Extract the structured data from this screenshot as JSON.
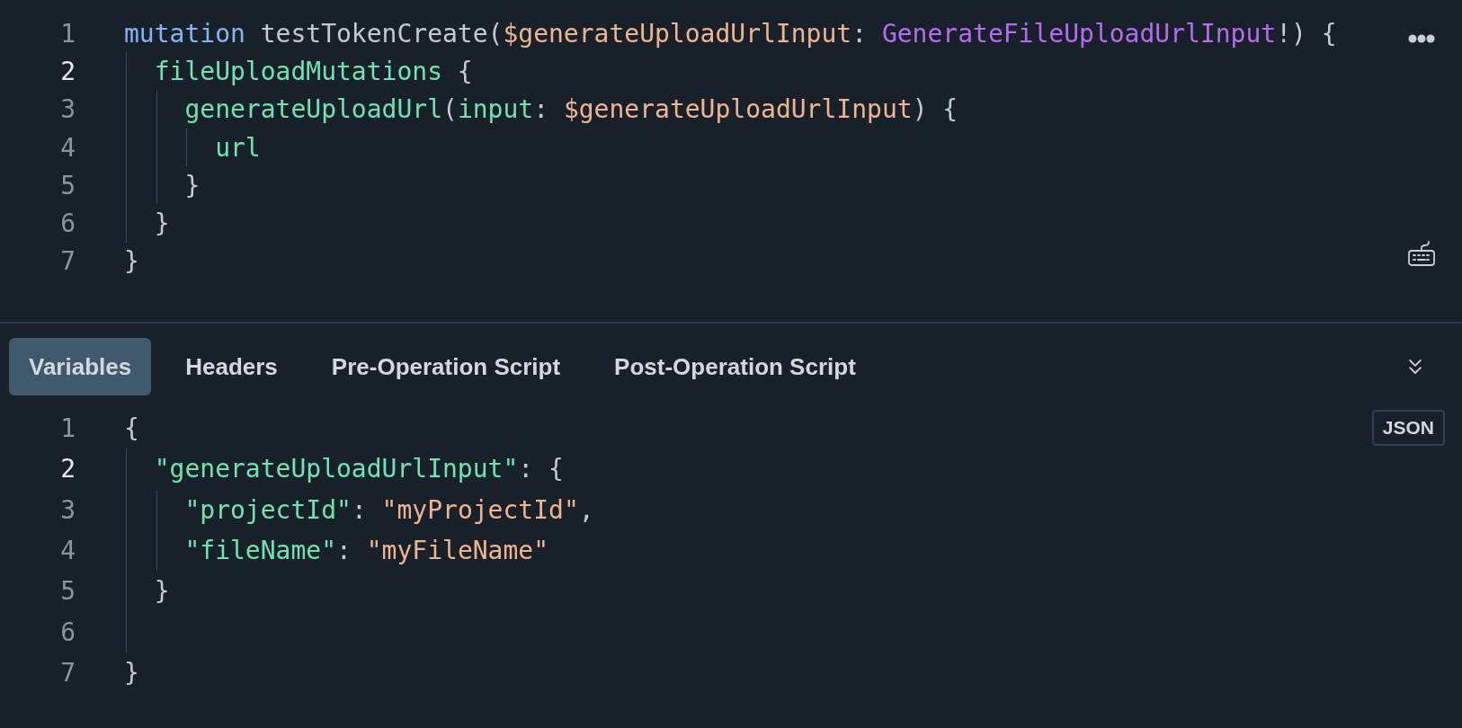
{
  "query_editor": {
    "lines": [
      {
        "number": "1",
        "active": false,
        "tokens": [
          {
            "kind": "keyword",
            "text": "mutation"
          },
          {
            "kind": "plain",
            "text": " testTokenCreate("
          },
          {
            "kind": "variable",
            "text": "$generateUploadUrlInput"
          },
          {
            "kind": "plain",
            "text": ": "
          },
          {
            "kind": "type",
            "text": "GenerateFileUploadUrlInput"
          },
          {
            "kind": "plain",
            "text": "!) {"
          }
        ]
      },
      {
        "number": "2",
        "active": true,
        "tokens": [
          {
            "kind": "field",
            "text": "  fileUploadMutations"
          },
          {
            "kind": "plain",
            "text": " {"
          }
        ]
      },
      {
        "number": "3",
        "active": false,
        "tokens": [
          {
            "kind": "field",
            "text": "    generateUploadUrl"
          },
          {
            "kind": "plain",
            "text": "("
          },
          {
            "kind": "field",
            "text": "input"
          },
          {
            "kind": "plain",
            "text": ": "
          },
          {
            "kind": "variable",
            "text": "$generateUploadUrlInput"
          },
          {
            "kind": "plain",
            "text": ") {"
          }
        ]
      },
      {
        "number": "4",
        "active": false,
        "tokens": [
          {
            "kind": "field",
            "text": "      url"
          }
        ]
      },
      {
        "number": "5",
        "active": false,
        "tokens": [
          {
            "kind": "plain",
            "text": "    }"
          }
        ]
      },
      {
        "number": "6",
        "active": false,
        "tokens": [
          {
            "kind": "plain",
            "text": "  }"
          }
        ]
      },
      {
        "number": "7",
        "active": false,
        "tokens": [
          {
            "kind": "plain",
            "text": "}"
          }
        ]
      }
    ]
  },
  "tabs": [
    {
      "label": "Variables",
      "selected": true
    },
    {
      "label": "Headers",
      "selected": false
    },
    {
      "label": "Pre-Operation Script",
      "selected": false
    },
    {
      "label": "Post-Operation Script",
      "selected": false
    }
  ],
  "format_badge": "JSON",
  "variables_editor": {
    "lines": [
      {
        "number": "1",
        "active": false,
        "tokens": [
          {
            "kind": "plain",
            "text": "{"
          }
        ]
      },
      {
        "number": "2",
        "active": true,
        "tokens": [
          {
            "kind": "field",
            "text": "  \"generateUploadUrlInput\""
          },
          {
            "kind": "plain",
            "text": ": {"
          }
        ]
      },
      {
        "number": "3",
        "active": false,
        "tokens": [
          {
            "kind": "field",
            "text": "    \"projectId\""
          },
          {
            "kind": "plain",
            "text": ": "
          },
          {
            "kind": "string",
            "text": "\"myProjectId\""
          },
          {
            "kind": "plain",
            "text": ","
          }
        ]
      },
      {
        "number": "4",
        "active": false,
        "tokens": [
          {
            "kind": "field",
            "text": "    \"fileName\""
          },
          {
            "kind": "plain",
            "text": ": "
          },
          {
            "kind": "string",
            "text": "\"myFileName\""
          }
        ]
      },
      {
        "number": "5",
        "active": false,
        "tokens": [
          {
            "kind": "plain",
            "text": "  }"
          }
        ]
      },
      {
        "number": "6",
        "active": false
      },
      {
        "number": "7",
        "active": false,
        "tokens": [
          {
            "kind": "plain",
            "text": "}"
          }
        ]
      }
    ]
  }
}
